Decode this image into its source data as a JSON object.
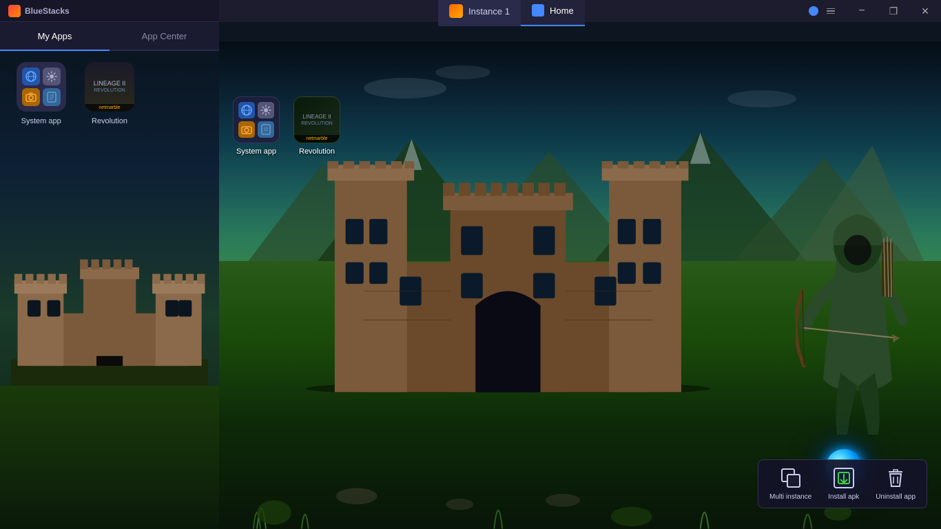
{
  "app": {
    "name": "BlueStacks",
    "logo_color": "#ff4400"
  },
  "left_panel": {
    "title": "BlueStacks",
    "tabs": [
      {
        "id": "my-apps",
        "label": "My Apps",
        "active": true
      },
      {
        "id": "app-center",
        "label": "App Center",
        "active": false
      }
    ],
    "apps": [
      {
        "id": "system-app",
        "label": "System app",
        "type": "system"
      },
      {
        "id": "revolution",
        "label": "Revolution",
        "type": "revolution"
      }
    ]
  },
  "instance_tab": {
    "label": "Instance 1",
    "number": "1"
  },
  "home_tab": {
    "label": "Home"
  },
  "game_apps": [
    {
      "id": "system-app-game",
      "label": "System app",
      "type": "system"
    },
    {
      "id": "revolution-game",
      "label": "Revolution",
      "type": "revolution"
    }
  ],
  "toolbar": {
    "buttons": [
      {
        "id": "multi-instance",
        "label": "Multi instance"
      },
      {
        "id": "install-apk",
        "label": "Install apk"
      },
      {
        "id": "uninstall-app",
        "label": "Uninstall app"
      }
    ]
  },
  "window_controls": {
    "minimize": "−",
    "restore": "❐",
    "close": "✕"
  }
}
